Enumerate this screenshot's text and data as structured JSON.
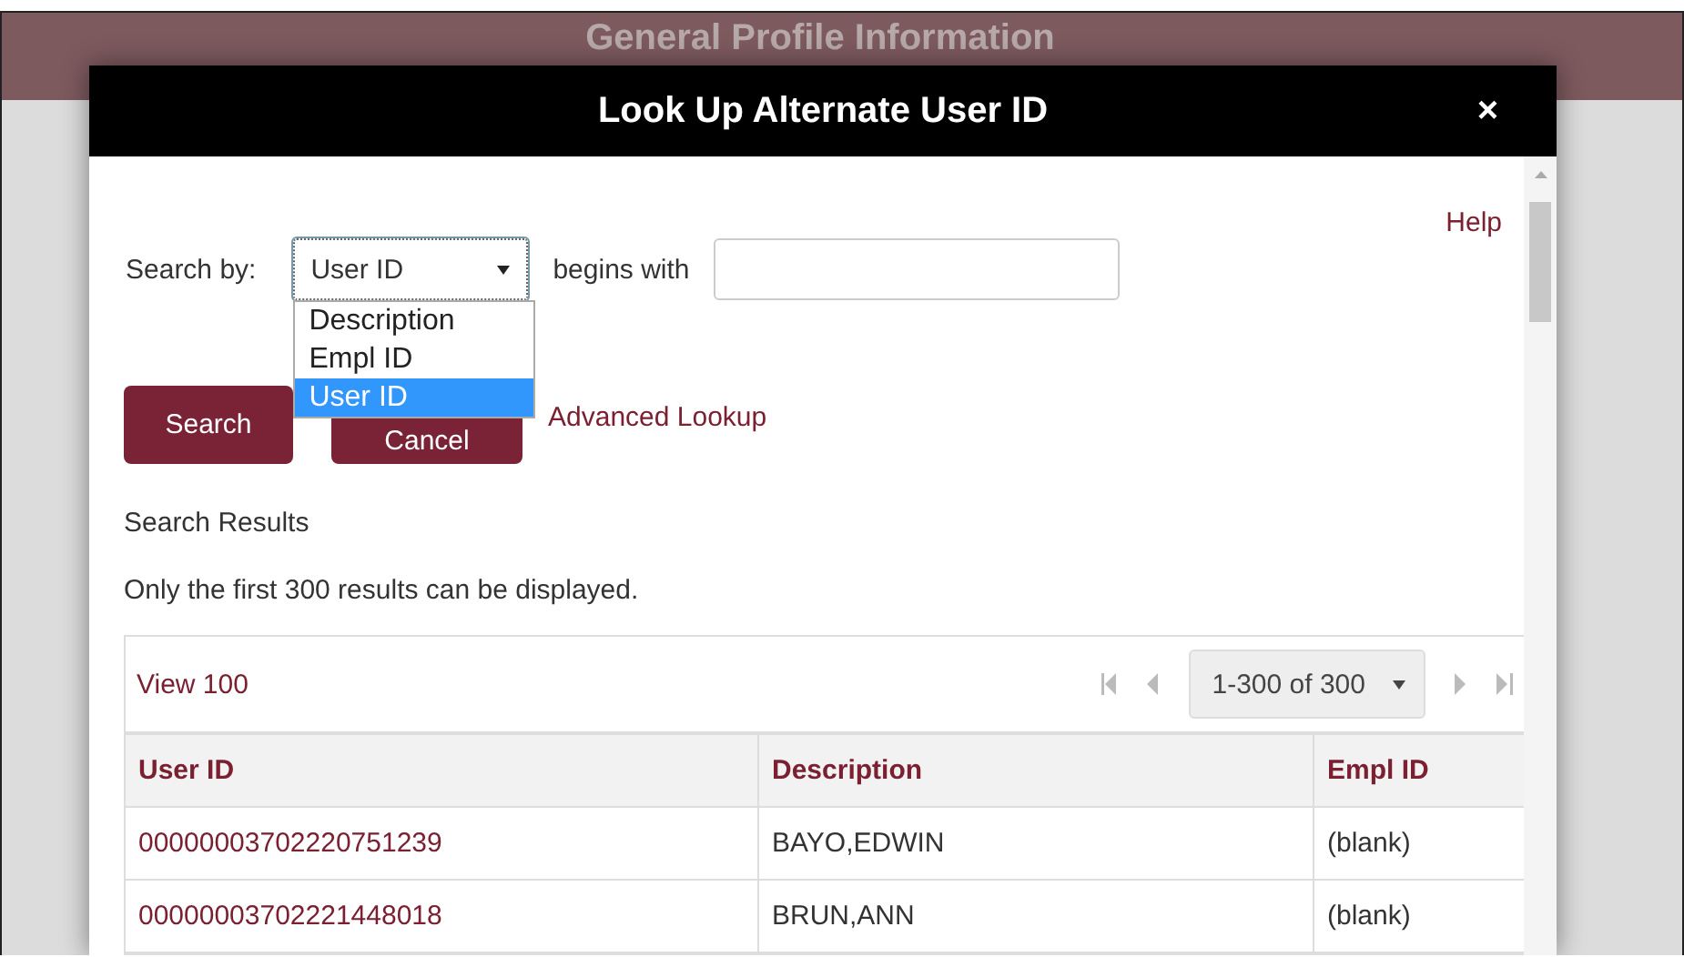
{
  "background_page": {
    "title": "General Profile Information"
  },
  "dialog": {
    "title": "Look Up Alternate User ID",
    "close": "×",
    "help": "Help",
    "search_by": {
      "label": "Search by:",
      "value": "User ID",
      "expanded": true,
      "options": [
        {
          "label": "Description",
          "selected": false
        },
        {
          "label": "Empl ID",
          "selected": false
        },
        {
          "label": "User ID",
          "selected": true
        }
      ]
    },
    "operator": "begins with",
    "buttons": [
      "Search",
      "Cancel"
    ],
    "advanced_lookup": "Advanced Lookup",
    "results_heading": "Search Results",
    "results_note": "Only the first 300 results can be displayed.",
    "grid": {
      "view_link": "View 100",
      "page_range": "1-300 of 300",
      "columns": [
        "User ID",
        "Description",
        "Empl ID"
      ],
      "rows": [
        [
          "00000003702220751239",
          "BAYO,EDWIN",
          "(blank)"
        ],
        [
          "00000003702221448018",
          "BRUN,ANN",
          "(blank)"
        ]
      ]
    }
  }
}
